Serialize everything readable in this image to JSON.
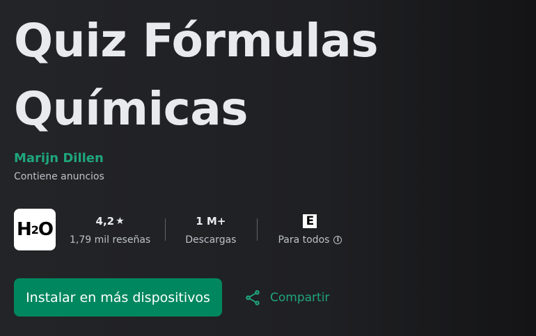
{
  "app": {
    "title_line1": "Quiz Fórmulas",
    "title_line2": "Químicas",
    "developer": "Marijn Dillen",
    "ads_notice": "Contiene anuncios",
    "icon_text_main": "H",
    "icon_text_sub": "2",
    "icon_text_end": "O"
  },
  "stats": {
    "rating": "4,2",
    "rating_star": "★",
    "reviews": "1,79 mil reseñas",
    "downloads": "1 M+",
    "downloads_label": "Descargas",
    "content_rating_badge": "E",
    "content_rating_label": "Para todos"
  },
  "actions": {
    "install_label": "Instalar en más dispositivos",
    "share_label": "Compartir"
  },
  "colors": {
    "accent": "#01875f",
    "link_green": "#1fa67a",
    "background": "#202124"
  }
}
